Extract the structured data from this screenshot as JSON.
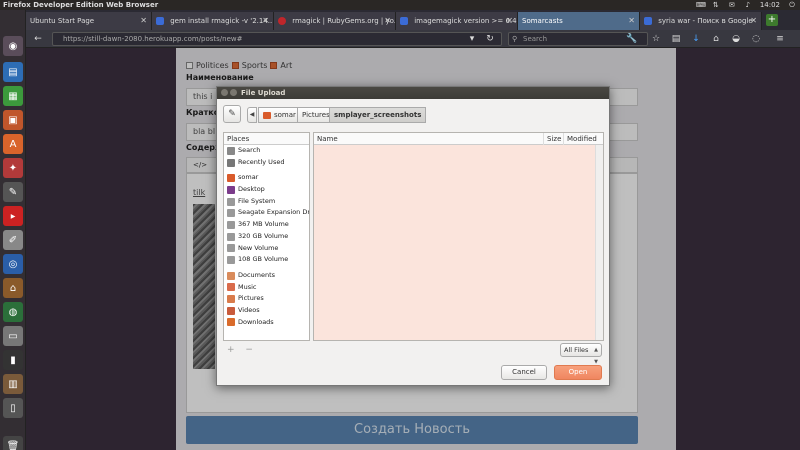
{
  "system": {
    "window_title": "Firefox Developer Edition Web Browser",
    "time": "14:02"
  },
  "tabs": [
    {
      "label": "Ubuntu Start Page",
      "favicon_color": "#d9542b",
      "active": false
    },
    {
      "label": "gem install rmagick -v '2.14....",
      "favicon_color": "#3b6bd6",
      "active": false
    },
    {
      "label": "rmagick | RubyGems.org | yo...",
      "favicon_color": "#c0262b",
      "active": false
    },
    {
      "label": "imagemagick version >= 6.4....",
      "favicon_color": "#3b6bd6",
      "active": false
    },
    {
      "label": "Somarcasts",
      "favicon_color": "",
      "active": true
    },
    {
      "label": "syria war - Поиск в Google",
      "favicon_color": "#3b6bd6",
      "active": false
    }
  ],
  "navbar": {
    "url": "https://still-dawn-2080.herokuapp.com/posts/new#",
    "search_placeholder": "Search"
  },
  "page": {
    "categories": [
      {
        "label": "Politices",
        "checked": false
      },
      {
        "label": "Sports",
        "checked": true
      },
      {
        "label": "Art",
        "checked": true
      }
    ],
    "name_label": "Наименование",
    "name_value": "this i",
    "short_label": "Кратко",
    "short_value": "bla bl",
    "content_label": "Содерж",
    "editor_tool": "</>",
    "editor_link": "tilk",
    "submit_label": "Создать Новость"
  },
  "dialog": {
    "title": "File Upload",
    "path": [
      "somar",
      "Pictures",
      "smplayer_screenshots"
    ],
    "places_header": "Places",
    "places": [
      {
        "label": "Search",
        "icon": "search-icon",
        "color": "#888"
      },
      {
        "label": "Recently Used",
        "icon": "clock-icon",
        "color": "#777"
      },
      {
        "sep": true
      },
      {
        "label": "somar",
        "icon": "home-folder-icon",
        "color": "#d95b2b"
      },
      {
        "label": "Desktop",
        "icon": "desktop-icon",
        "color": "#7b3b8a"
      },
      {
        "label": "File System",
        "icon": "drive-icon",
        "color": "#999"
      },
      {
        "label": "Seagate Expansion Dr...",
        "icon": "drive-icon",
        "color": "#999"
      },
      {
        "label": "367 MB Volume",
        "icon": "drive-icon",
        "color": "#999"
      },
      {
        "label": "320 GB Volume",
        "icon": "drive-icon",
        "color": "#999"
      },
      {
        "label": "New Volume",
        "icon": "drive-icon",
        "color": "#999"
      },
      {
        "label": "108 GB Volume",
        "icon": "drive-icon",
        "color": "#999"
      },
      {
        "sep": true
      },
      {
        "label": "Documents",
        "icon": "documents-folder-icon",
        "color": "#d98b5b"
      },
      {
        "label": "Music",
        "icon": "music-folder-icon",
        "color": "#d96b4b"
      },
      {
        "label": "Pictures",
        "icon": "pictures-folder-icon",
        "color": "#d97b4b"
      },
      {
        "label": "Videos",
        "icon": "videos-folder-icon",
        "color": "#c95b3b"
      },
      {
        "label": "Downloads",
        "icon": "downloads-folder-icon",
        "color": "#d96b2b"
      }
    ],
    "columns": [
      "Name",
      "Size",
      "Modified"
    ],
    "filter": "All Files",
    "cancel_label": "Cancel",
    "open_label": "Open"
  }
}
